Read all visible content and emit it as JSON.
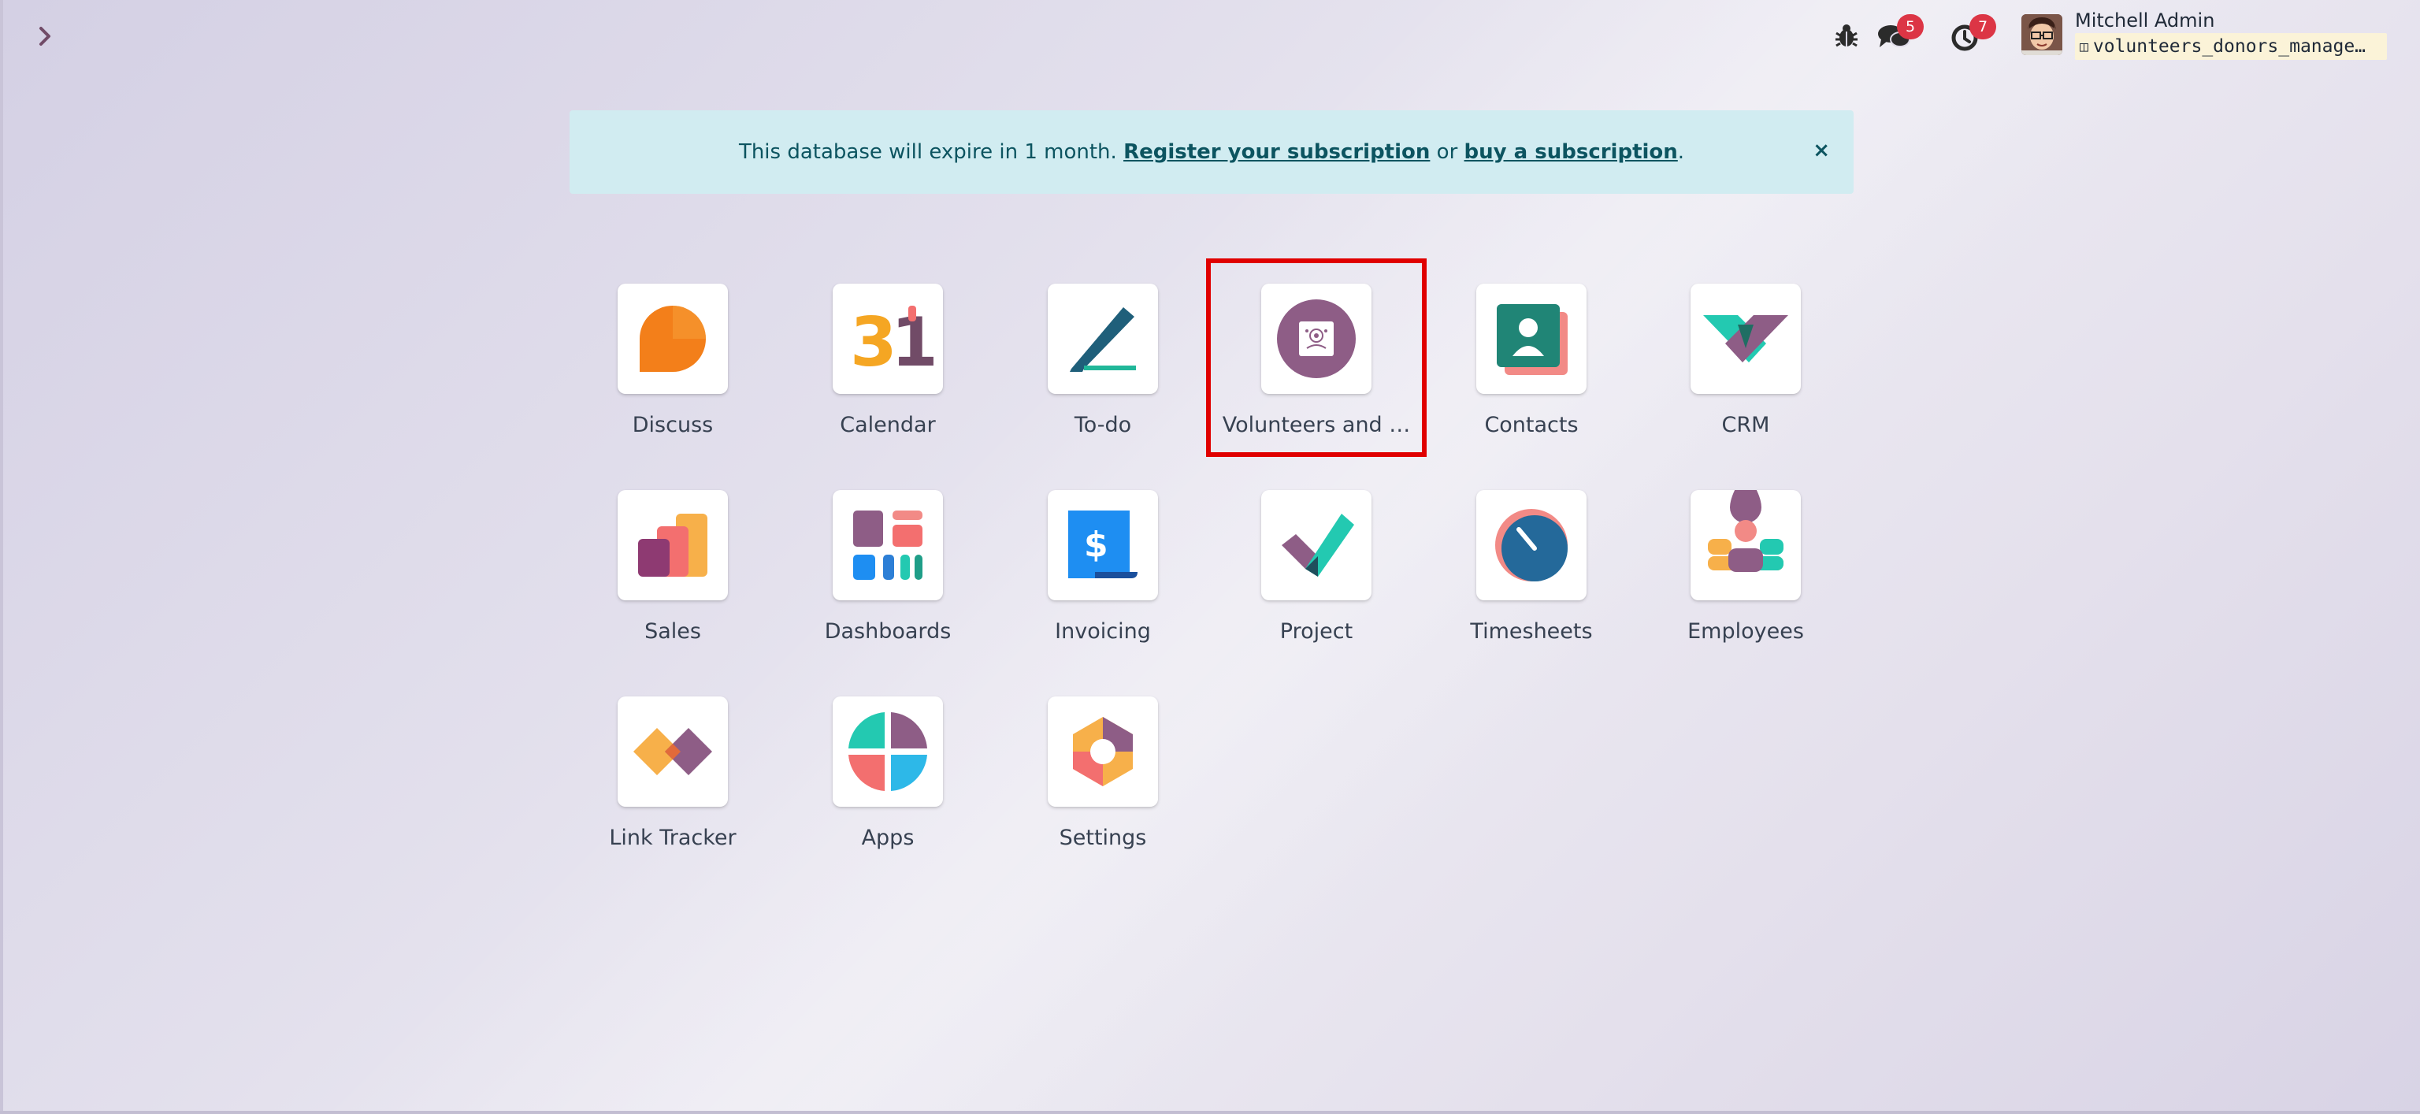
{
  "systray": {
    "messages_count": "5",
    "activity_count": "7",
    "user_name": "Mitchell Admin",
    "database_name": "volunteers_donors_manage…"
  },
  "alert": {
    "text_before": "This database will expire in 1 month. ",
    "register_link": "Register your subscription",
    "text_middle": " or ",
    "buy_link": "buy a subscription",
    "text_after": ".",
    "close_label": "×"
  },
  "apps": [
    {
      "label": "Discuss",
      "icon": "discuss-icon"
    },
    {
      "label": "Calendar",
      "icon": "calendar-icon",
      "icon_text": "31"
    },
    {
      "label": "To-do",
      "icon": "todo-icon"
    },
    {
      "label": "Volunteers and …",
      "icon": "volunteers-icon"
    },
    {
      "label": "Contacts",
      "icon": "contacts-icon"
    },
    {
      "label": "CRM",
      "icon": "crm-icon"
    },
    {
      "label": "Sales",
      "icon": "sales-icon"
    },
    {
      "label": "Dashboards",
      "icon": "dashboards-icon"
    },
    {
      "label": "Invoicing",
      "icon": "invoicing-icon",
      "icon_text": "$"
    },
    {
      "label": "Project",
      "icon": "project-icon"
    },
    {
      "label": "Timesheets",
      "icon": "timesheets-icon"
    },
    {
      "label": "Employees",
      "icon": "employees-icon"
    },
    {
      "label": "Link Tracker",
      "icon": "link-tracker-icon"
    },
    {
      "label": "Apps",
      "icon": "apps-icon"
    },
    {
      "label": "Settings",
      "icon": "settings-icon"
    }
  ],
  "colors": {
    "accent": "#714B67",
    "alert_bg": "#d1ecf1",
    "alert_text": "#0c5460",
    "badge": "#dc3545",
    "highlight": "#e00000"
  }
}
